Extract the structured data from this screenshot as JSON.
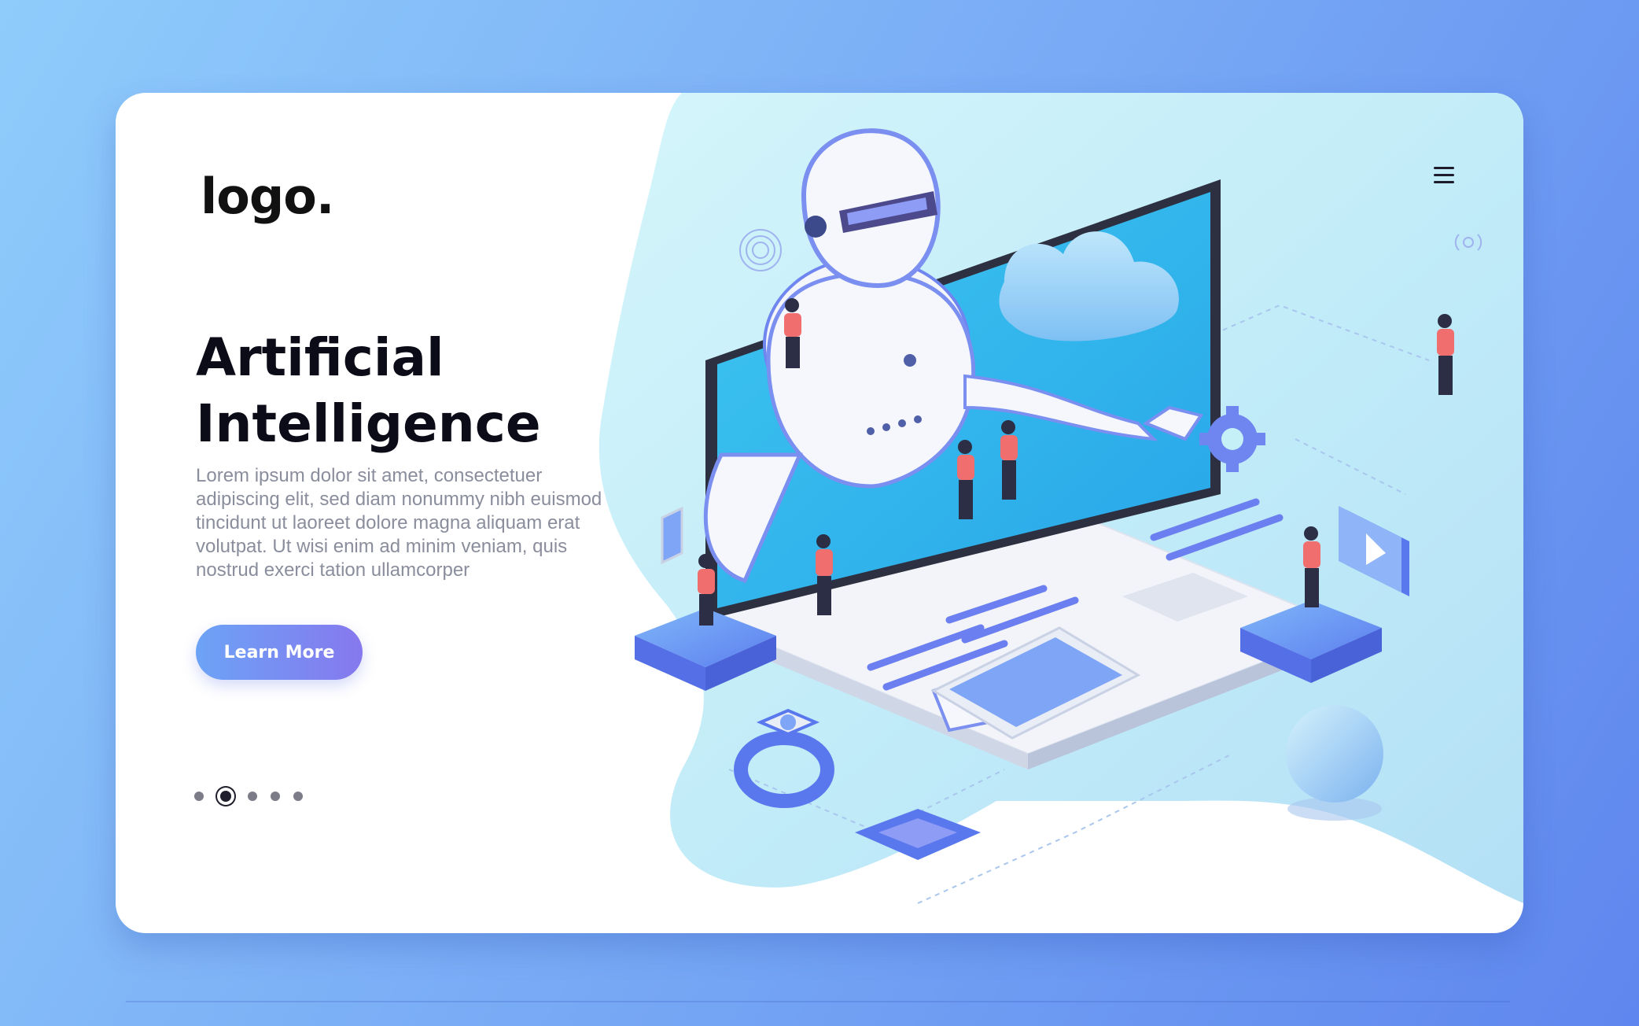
{
  "header": {
    "logo": "logo.",
    "menu_icon": "hamburger-menu-icon"
  },
  "hero": {
    "title": "Artificial Intelligence",
    "description": "Lorem ipsum dolor sit amet, consectetuer adipiscing elit, sed diam nonummy nibh euismod tincidunt ut laoreet dolore magna aliquam erat volutpat. Ut wisi enim ad minim veniam, quis nostrud exerci tation ullamcorper",
    "cta_label": "Learn More"
  },
  "pagination": {
    "total": 5,
    "active_index": 1
  },
  "colors": {
    "background_start": "#8fccfb",
    "background_end": "#5f86ee",
    "accent_blue": "#6ca3f6",
    "accent_purple": "#8678ee",
    "illustration_blob": "#c5f0f8",
    "figure_shirt": "#f06e6e"
  },
  "illustration": {
    "elements": [
      "robot",
      "laptop",
      "cloud-icon",
      "gear-icon",
      "smartphone",
      "smartwatch",
      "microchip",
      "sphere",
      "play-video-icon",
      "platforms",
      "people"
    ]
  }
}
